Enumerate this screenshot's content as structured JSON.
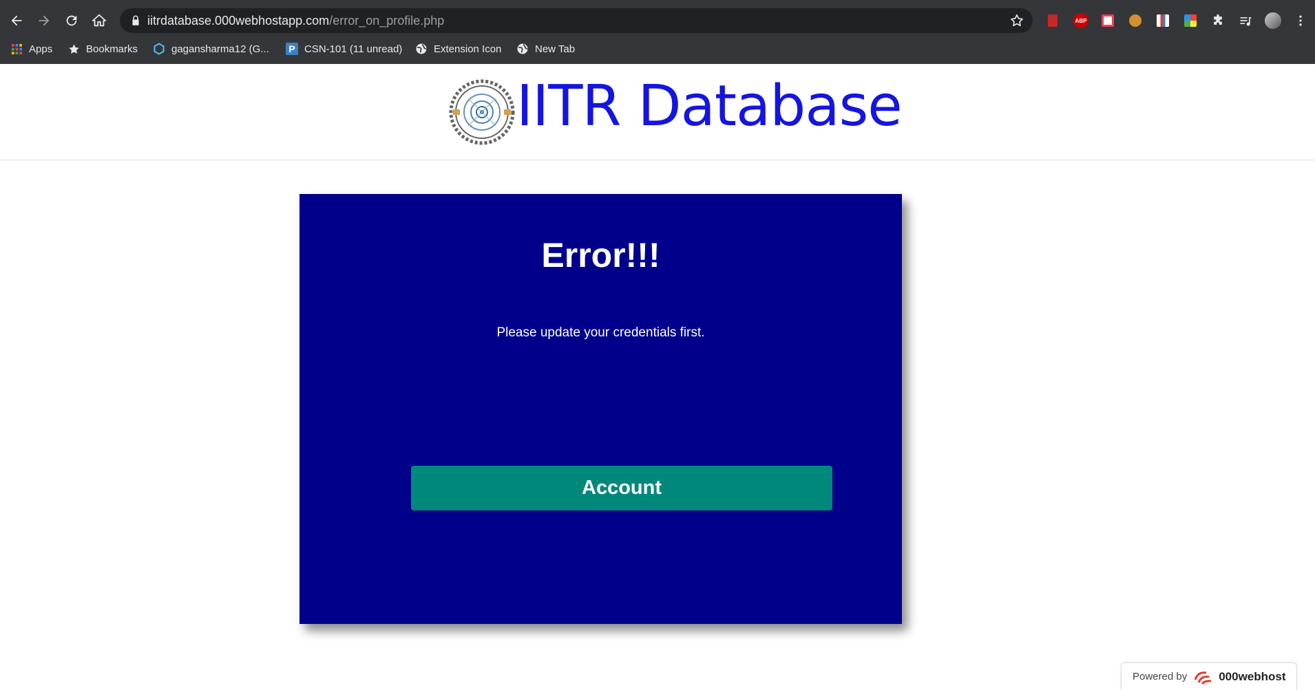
{
  "browser": {
    "url_domain": "iitrdatabase.000webhostapp.com",
    "url_path": "/error_on_profile.php",
    "bookmarks": [
      {
        "label": "Apps",
        "icon": "apps-grid-icon"
      },
      {
        "label": "Bookmarks",
        "icon": "star-icon"
      },
      {
        "label": "gagansharma12 (G...",
        "icon": "hexagon-icon"
      },
      {
        "label": "CSN-101 (11 unread)",
        "icon": "p-icon"
      },
      {
        "label": "Extension Icon",
        "icon": "globe-icon"
      },
      {
        "label": "New Tab",
        "icon": "globe-icon"
      }
    ],
    "extensions": {
      "abp_label": "ABP"
    }
  },
  "site": {
    "title": "IITR Database"
  },
  "error_card": {
    "title": "Error!!!",
    "message": "Please update your credentials first.",
    "button_label": "Account"
  },
  "footer": {
    "powered_label": "Powered by",
    "brand": "000webhost"
  },
  "colors": {
    "card_bg": "#00008b",
    "button_bg": "#00897b",
    "title_color": "#1515e0"
  }
}
